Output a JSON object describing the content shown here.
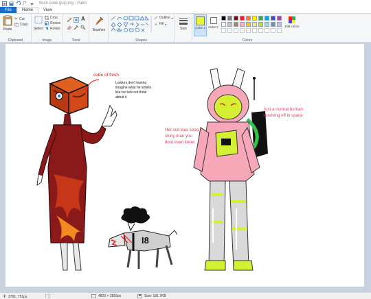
{
  "window": {
    "title": "flesh cube guy.png - Paint"
  },
  "tabs": [
    {
      "label": "File"
    },
    {
      "label": "Home"
    },
    {
      "label": "View"
    }
  ],
  "ribbon": {
    "clipboard": {
      "paste": "Paste",
      "cut": "Cut",
      "copy": "Copy",
      "group": "Clipboard"
    },
    "image": {
      "select": "Select",
      "crop": "Crop",
      "resize": "Resize",
      "rotate": "Rotate",
      "group": "Image"
    },
    "tools": {
      "group": "Tools"
    },
    "brushes": {
      "label": "Brushes"
    },
    "shapes": {
      "outline": "Outline",
      "fill": "Fill",
      "group": "Shapes"
    },
    "size": {
      "label": "Size"
    },
    "color1": {
      "label": "Color 1"
    },
    "color2": {
      "label": "Color 2"
    },
    "colors": {
      "group": "Colors",
      "edit": "Edit colors"
    }
  },
  "palette": [
    "#000000",
    "#7f7f7f",
    "#880015",
    "#ed1c24",
    "#ff7f27",
    "#fff200",
    "#22b14c",
    "#00a2e8",
    "#3f48cc",
    "#a349a4",
    "#ffffff",
    "#c3c3c3",
    "#b97a57",
    "#ffaec9",
    "#ffc90e",
    "#efe4b0",
    "#b5e61d",
    "#99d9ea",
    "#7092be",
    "#c8bfe7"
  ],
  "current_colors": {
    "color1": "#e8f53a",
    "color2": "#ffffff"
  },
  "canvas": {
    "annotations": {
      "cube_title": "cube of flesh",
      "cube_note_1": "Lowkey don't wanna",
      "cube_note_2": "imagine what he smells",
      "cube_note_3": "like but lets not think",
      "cube_note_4": "about it",
      "suit_1": "Her suit was sooo",
      "suit_2": "shiny man you",
      "suit_3": "dont even know",
      "human_1": "Just a normal human",
      "human_2": "surviving off in space",
      "dog_label": "I8"
    }
  },
  "status": {
    "cursor": "3791, 751px",
    "dimensions": "4820 × 2816px",
    "size": "Size: 181.7KB"
  }
}
